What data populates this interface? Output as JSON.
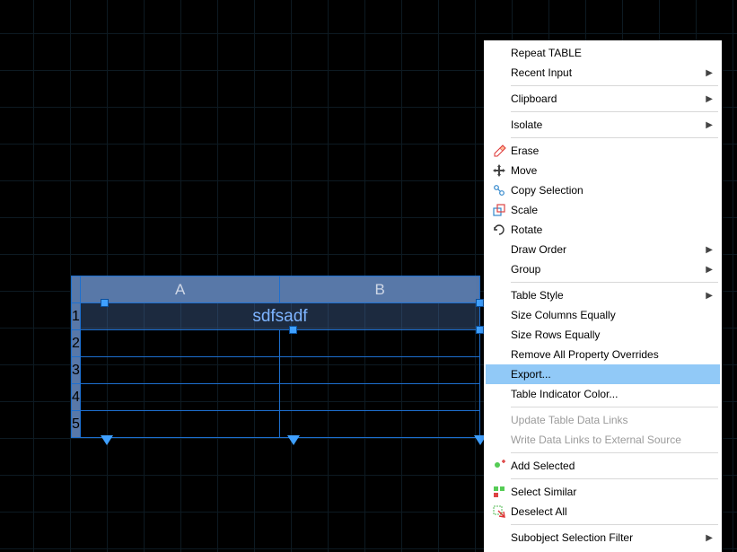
{
  "table": {
    "columns": [
      "A",
      "B"
    ],
    "rows": [
      "1",
      "2",
      "3",
      "4",
      "5"
    ],
    "title_text": "sdfsadf"
  },
  "menu": {
    "repeat": "Repeat TABLE",
    "recent_input": "Recent Input",
    "clipboard": "Clipboard",
    "isolate": "Isolate",
    "erase": "Erase",
    "move": "Move",
    "copy_sel": "Copy Selection",
    "scale": "Scale",
    "rotate": "Rotate",
    "draw_order": "Draw Order",
    "group": "Group",
    "table_style": "Table Style",
    "size_cols": "Size Columns Equally",
    "size_rows": "Size Rows Equally",
    "remove_over": "Remove All Property Overrides",
    "export": "Export...",
    "indicator": "Table Indicator Color...",
    "update_links": "Update Table Data Links",
    "write_links": "Write Data Links to External Source",
    "add_selected": "Add Selected",
    "select_similar": "Select Similar",
    "deselect_all": "Deselect All",
    "subobject": "Subobject Selection Filter"
  }
}
